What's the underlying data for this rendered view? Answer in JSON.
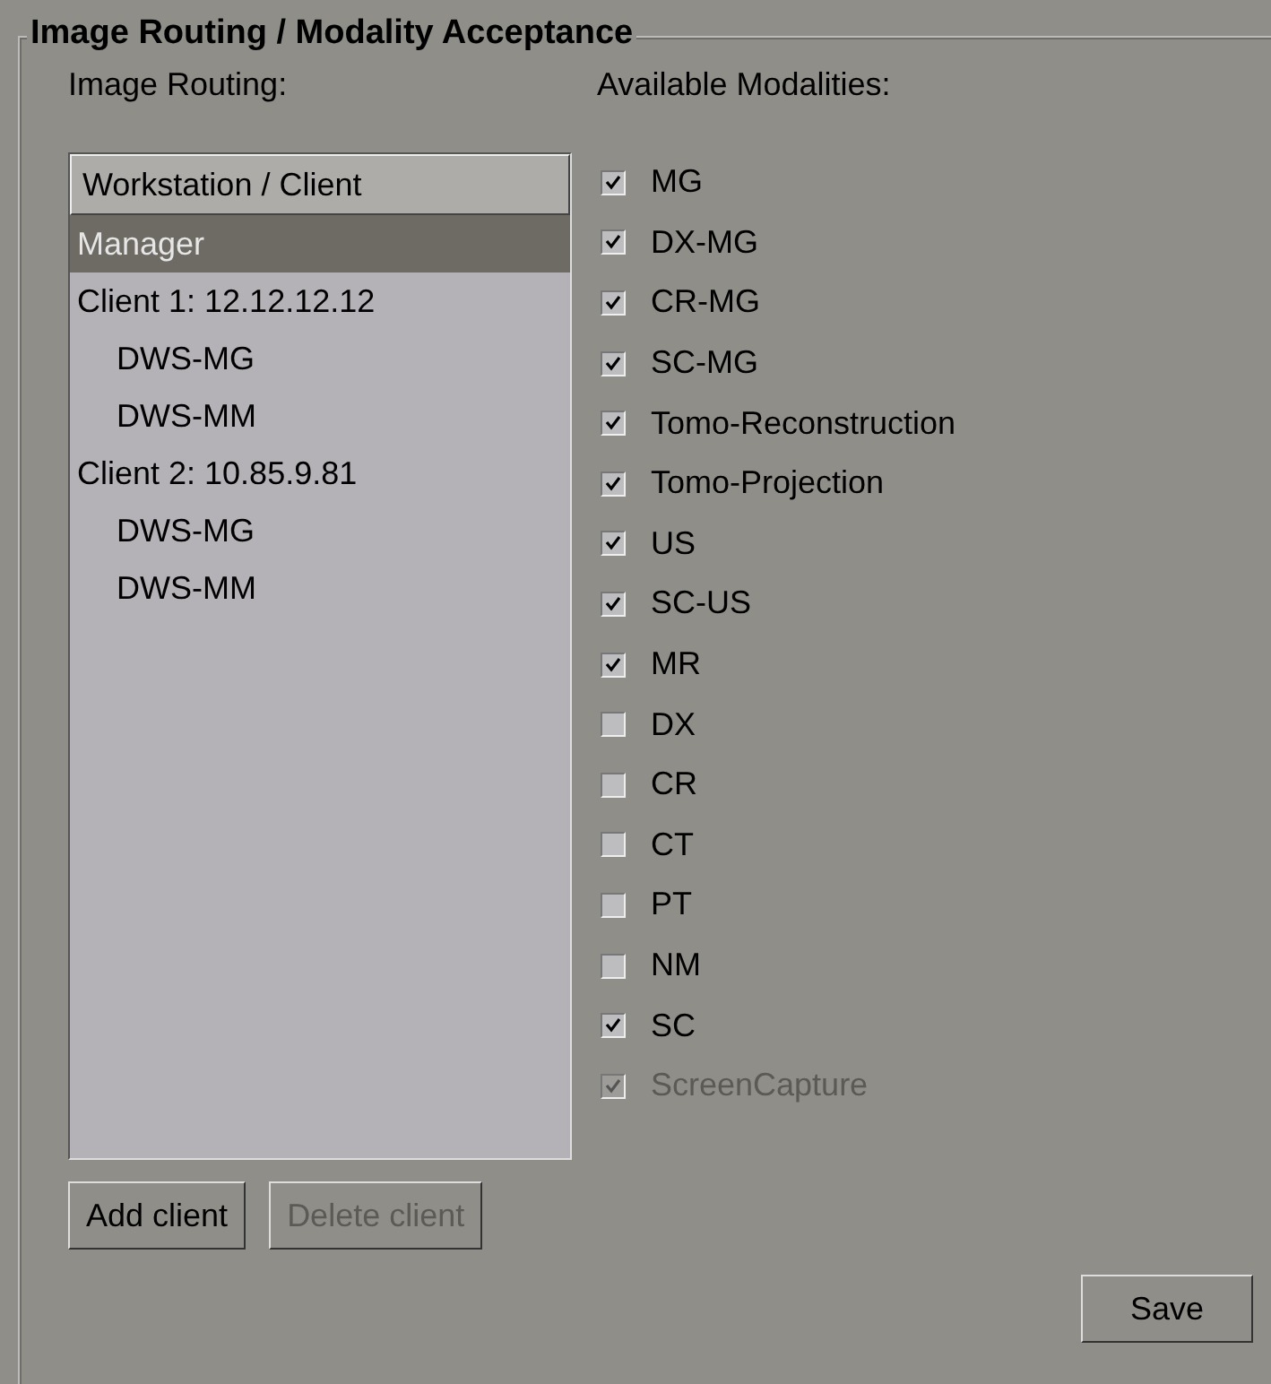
{
  "group": {
    "title": "Image Routing / Modality Acceptance"
  },
  "routing": {
    "label": "Image Routing:",
    "column": "Workstation / Client",
    "items": [
      {
        "label": "Manager",
        "selected": true
      },
      {
        "label": "Client 1: 12.12.12.12",
        "selected": false,
        "children": [
          {
            "label": "DWS-MG",
            "selected": false
          },
          {
            "label": "DWS-MM",
            "selected": false
          }
        ]
      },
      {
        "label": "Client 2: 10.85.9.81",
        "selected": false,
        "children": [
          {
            "label": "DWS-MG",
            "selected": false
          },
          {
            "label": "DWS-MM",
            "selected": false
          }
        ]
      }
    ]
  },
  "modalities": {
    "label": "Available Modalities:",
    "items": [
      {
        "label": "MG",
        "checked": true,
        "disabled": false
      },
      {
        "label": "DX-MG",
        "checked": true,
        "disabled": false
      },
      {
        "label": "CR-MG",
        "checked": true,
        "disabled": false
      },
      {
        "label": "SC-MG",
        "checked": true,
        "disabled": false
      },
      {
        "label": "Tomo-Reconstruction",
        "checked": true,
        "disabled": false
      },
      {
        "label": "Tomo-Projection",
        "checked": true,
        "disabled": false
      },
      {
        "label": "US",
        "checked": true,
        "disabled": false
      },
      {
        "label": "SC-US",
        "checked": true,
        "disabled": false
      },
      {
        "label": "MR",
        "checked": true,
        "disabled": false
      },
      {
        "label": "DX",
        "checked": false,
        "disabled": false
      },
      {
        "label": "CR",
        "checked": false,
        "disabled": false
      },
      {
        "label": "CT",
        "checked": false,
        "disabled": false
      },
      {
        "label": "PT",
        "checked": false,
        "disabled": false
      },
      {
        "label": "NM",
        "checked": false,
        "disabled": false
      },
      {
        "label": "SC",
        "checked": true,
        "disabled": false
      },
      {
        "label": "ScreenCapture",
        "checked": true,
        "disabled": true
      }
    ]
  },
  "buttons": [
    {
      "label": "Add client",
      "disabled": false
    },
    {
      "label": "Delete client",
      "disabled": true
    }
  ],
  "save": {
    "label": "Save",
    "disabled": false
  }
}
